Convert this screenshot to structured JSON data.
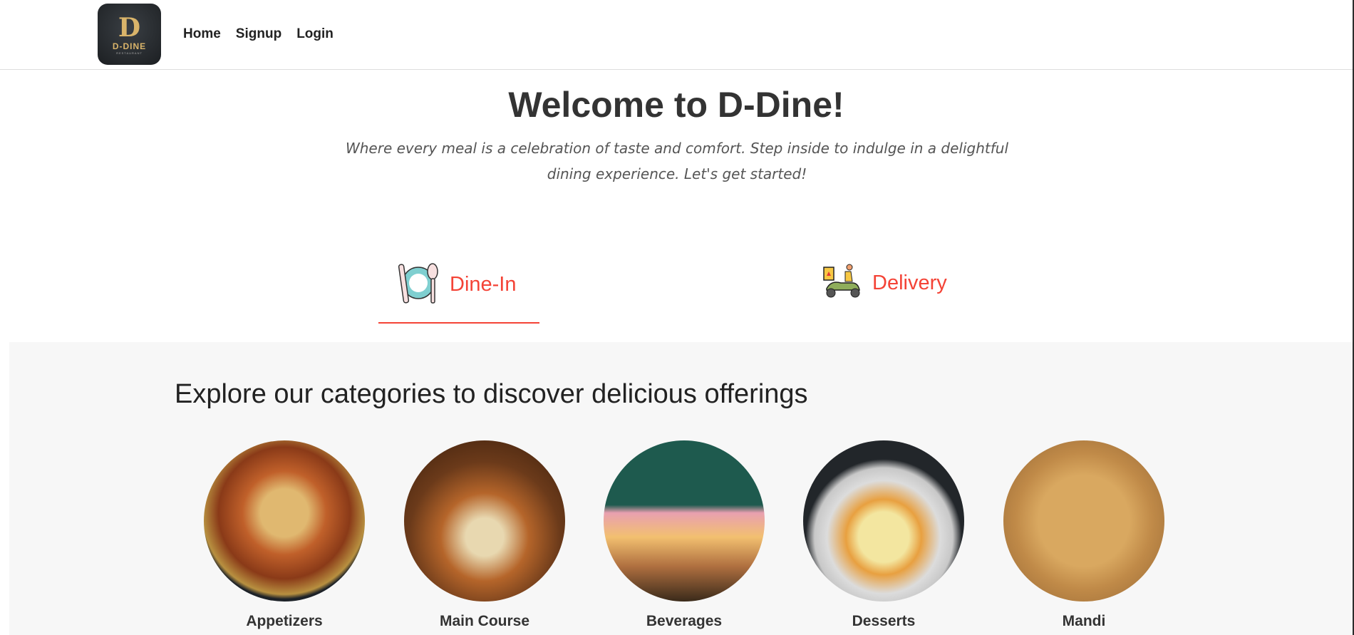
{
  "brand": {
    "logo_text": "D-DINE",
    "logo_sub": "RESTAURANT"
  },
  "nav": [
    {
      "label": "Home"
    },
    {
      "label": "Signup"
    },
    {
      "label": "Login"
    }
  ],
  "hero": {
    "title": "Welcome to D-Dine!",
    "subtitle": "Where every meal is a celebration of taste and comfort. Step inside to indulge in a delightful dining experience. Let's get started!"
  },
  "tabs": [
    {
      "label": "Dine-In",
      "icon": "plate-cutlery-icon",
      "active": true
    },
    {
      "label": "Delivery",
      "icon": "delivery-scooter-icon",
      "active": false
    }
  ],
  "categories_section": {
    "heading": "Explore our categories to discover delicious offerings",
    "items": [
      {
        "label": "Appetizers"
      },
      {
        "label": "Main Course"
      },
      {
        "label": "Beverages"
      },
      {
        "label": "Desserts"
      },
      {
        "label": "Mandi"
      }
    ]
  },
  "colors": {
    "accent": "#f44336",
    "section_bg": "#f7f7f7"
  }
}
